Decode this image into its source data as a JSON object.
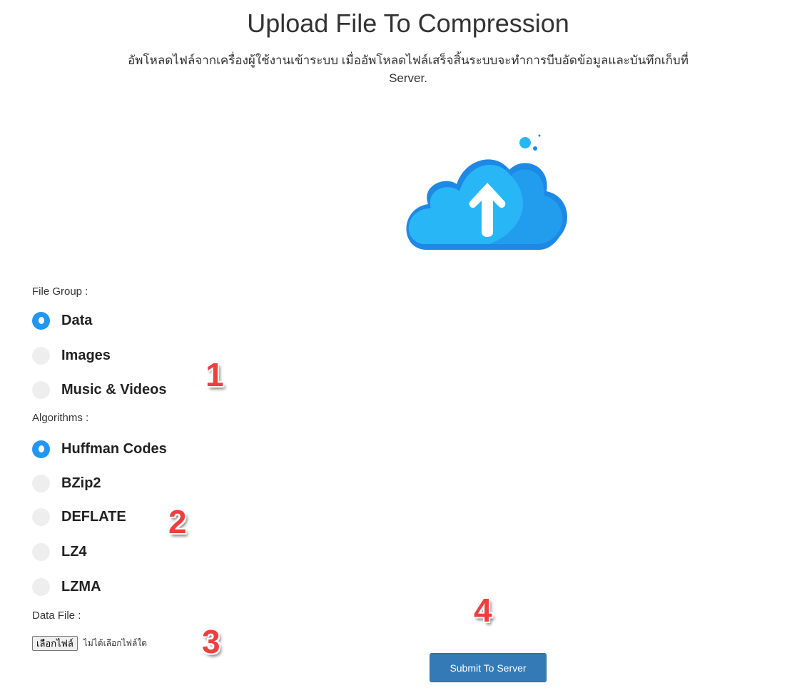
{
  "header": {
    "title": "Upload File To Compression",
    "subtitle_line1": "อัพโหลดไฟล์จากเครื่องผู้ใช้งานเข้าระบบ เมื่ออัพโหลดไฟล์เสร็จสิ้นระบบจะทำการบีบอัดข้อมูลและบันทึกเก็บที่",
    "subtitle_line2": "Server."
  },
  "upload_icon": {
    "name": "cloud-upload-icon",
    "colors": {
      "cloud_light": "#29b6f6",
      "cloud_dark": "#1e88e5",
      "arrow": "#ffffff"
    }
  },
  "file_group": {
    "label": "File Group :",
    "options": [
      {
        "label": "Data",
        "checked": true
      },
      {
        "label": "Images",
        "checked": false
      },
      {
        "label": "Music & Videos",
        "checked": false
      }
    ]
  },
  "algorithms": {
    "label": "Algorithms :",
    "options": [
      {
        "label": "Huffman Codes",
        "checked": true
      },
      {
        "label": "BZip2",
        "checked": false
      },
      {
        "label": "DEFLATE",
        "checked": false
      },
      {
        "label": "LZ4",
        "checked": false
      },
      {
        "label": "LZMA",
        "checked": false
      }
    ]
  },
  "data_file": {
    "label": "Data File :",
    "button_label": "เลือกไฟล์",
    "status": "ไม่ได้เลือกไฟล์ใด"
  },
  "submit": {
    "label": "Submit To Server"
  },
  "step_markers": [
    "1",
    "2",
    "3",
    "4"
  ],
  "colors": {
    "accent": "#2196f3",
    "primary_button": "#337ab7",
    "marker": "#ee3f3f"
  }
}
